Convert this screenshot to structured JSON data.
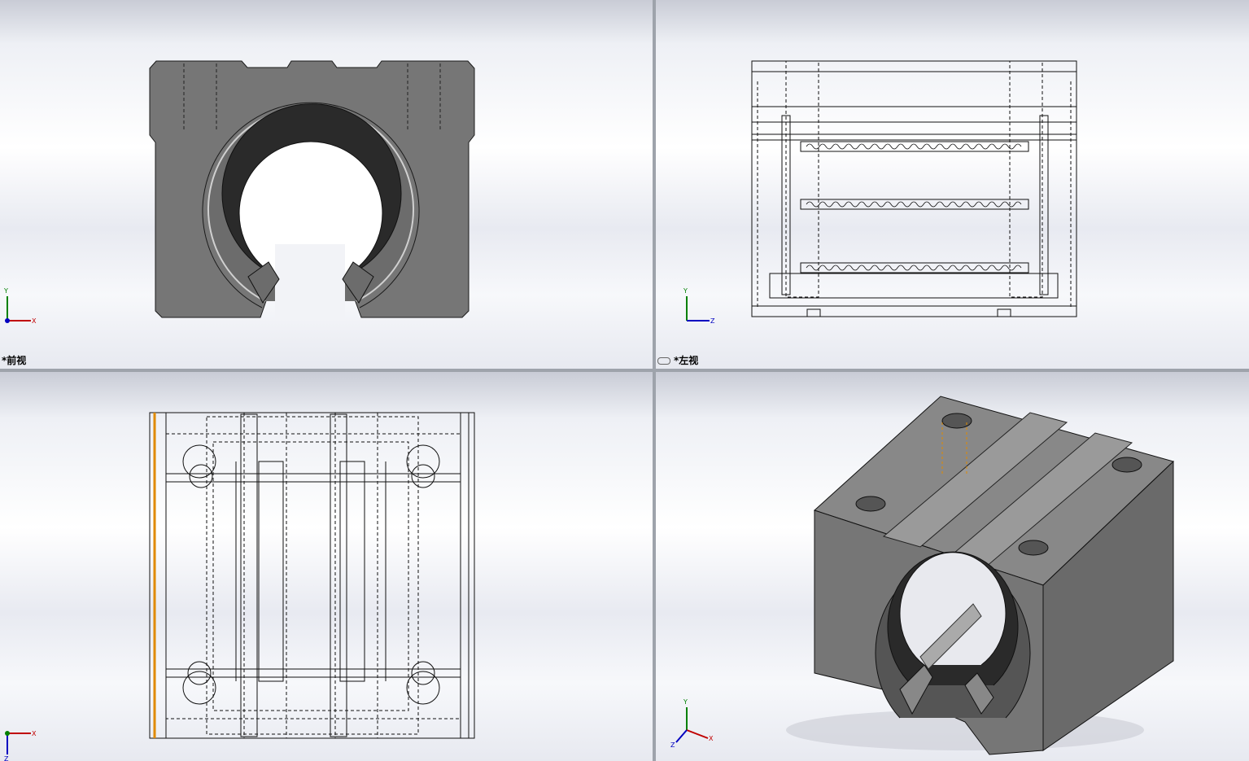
{
  "viewports": {
    "front": {
      "label": "*前视",
      "axes": [
        "Y",
        "X"
      ]
    },
    "left": {
      "label": "*左视",
      "axes": [
        "Y",
        "Z"
      ]
    },
    "top": {
      "label": "",
      "axes": [
        "X",
        "Z"
      ]
    },
    "iso": {
      "label": "",
      "axes": [
        "Y",
        "X",
        "Z"
      ]
    }
  },
  "colors": {
    "part_face": "#767676",
    "part_dark": "#5e5e5e",
    "bore_dark": "#2a2a2a",
    "edge": "#1a1a1a",
    "divider": "#9ea3ab",
    "axis_x": "#c00000",
    "axis_y": "#008000",
    "axis_z": "#0000c0",
    "highlight": "#e08a00"
  }
}
